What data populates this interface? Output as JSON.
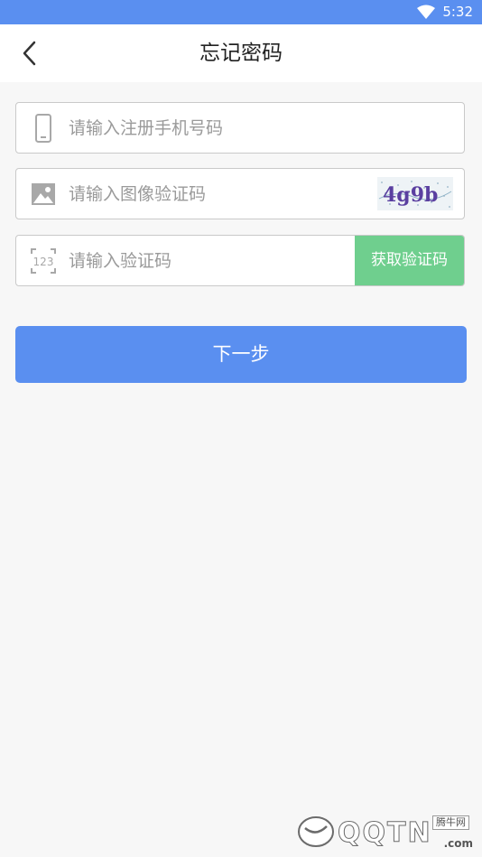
{
  "status_bar": {
    "time": "5:32",
    "wifi_icon": "wifi-icon"
  },
  "header": {
    "title": "忘记密码",
    "back_icon": "chevron-left-icon"
  },
  "form": {
    "phone": {
      "placeholder": "请输入注册手机号码",
      "icon": "phone-icon"
    },
    "image_code": {
      "placeholder": "请输入图像验证码",
      "icon": "image-icon",
      "captcha_text": "4g9b"
    },
    "sms_code": {
      "placeholder": "请输入验证码",
      "icon": "number-123-icon",
      "icon_text": "123",
      "get_code_label": "获取验证码"
    }
  },
  "next_button": {
    "label": "下一步"
  },
  "watermark": {
    "brand": "QQTN",
    "cn": "腾牛网",
    "domain": ".com"
  },
  "colors": {
    "primary": "#5a8ff0",
    "success": "#6fcf8e",
    "background": "#f7f7f7",
    "border": "#c9c9c9",
    "placeholder": "#9a9a9a"
  }
}
